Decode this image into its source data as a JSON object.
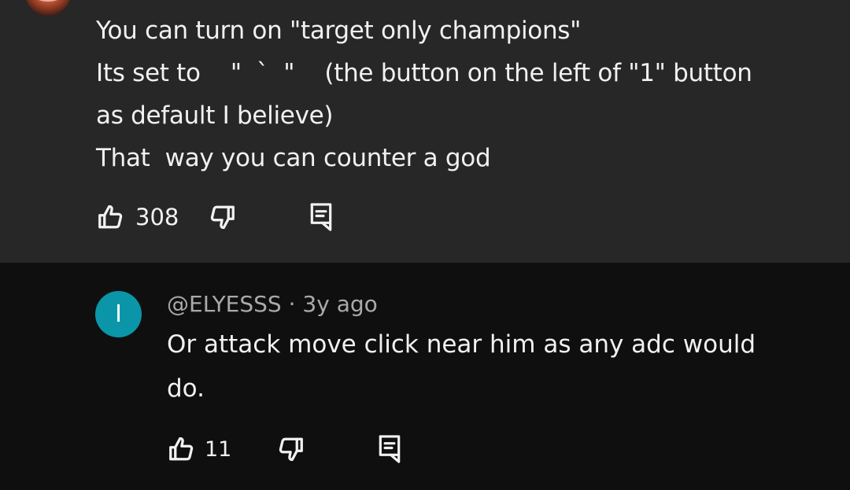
{
  "top_comment": {
    "lines": [
      "You can turn on \"target only champions\"",
      "Its set to    \"  `  \"    (the button on the left of \"1\" button",
      "as default I believe)",
      "That  way you can counter a god"
    ],
    "like_count": "308"
  },
  "reply": {
    "avatar_letter": "I",
    "avatar_color": "#0a95a8",
    "author": "@ELYESSS",
    "separator": "·",
    "time": "3y ago",
    "text": "Or attack move click near him as any adc would do.",
    "like_count": "11"
  },
  "icons": {
    "like": "thumbs-up-icon",
    "dislike": "thumbs-down-icon",
    "reply": "reply-comment-icon"
  },
  "colors": {
    "top_bg": "#272727",
    "page_bg": "#0f0f0f",
    "meta_text": "#aaaaaa"
  }
}
